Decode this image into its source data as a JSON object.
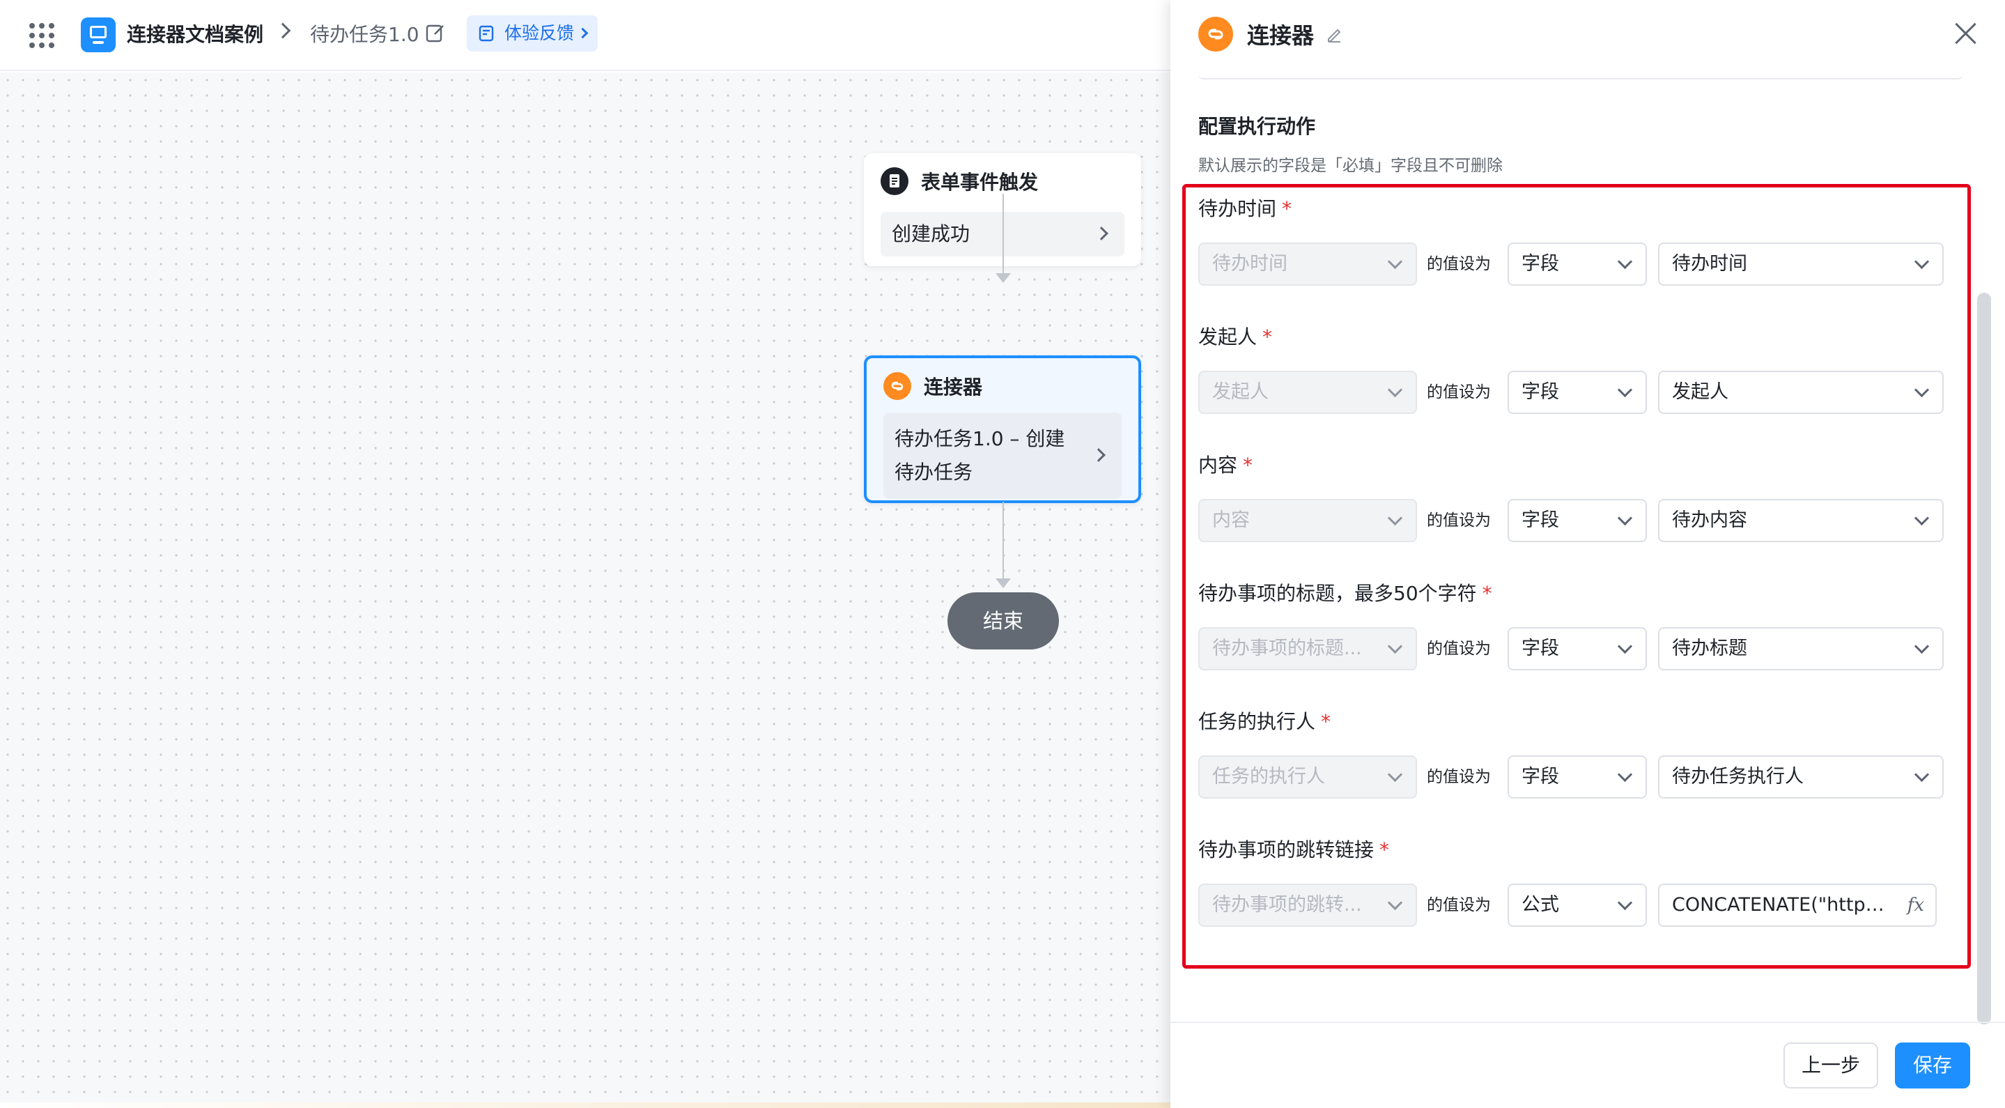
{
  "header": {
    "app_name": "连接器文档案例",
    "page_name": "待办任务1.0",
    "feedback_label": "体验反馈"
  },
  "canvas": {
    "trigger": {
      "title": "表单事件触发",
      "body": "创建成功"
    },
    "connector": {
      "title": "连接器",
      "body": "待办任务1.0 – 创建待办任务"
    },
    "end_label": "结束"
  },
  "panel": {
    "title": "连接器",
    "section_title": "配置执行动作",
    "section_desc": "默认展示的字段是「必填」字段且不可删除",
    "set_as_label": "的值设为",
    "fields": [
      {
        "label": "待办时间",
        "target": "待办时间",
        "mode": "字段",
        "value": "待办时间"
      },
      {
        "label": "发起人",
        "target": "发起人",
        "mode": "字段",
        "value": "发起人"
      },
      {
        "label": "内容",
        "target": "内容",
        "mode": "字段",
        "value": "待办内容"
      },
      {
        "label": "待办事项的标题，最多50个字符",
        "target": "待办事项的标题...",
        "mode": "字段",
        "value": "待办标题"
      },
      {
        "label": "任务的执行人",
        "target": "任务的执行人",
        "mode": "字段",
        "value": "待办任务执行人"
      },
      {
        "label": "待办事项的跳转链接",
        "target": "待办事项的跳转...",
        "mode": "公式",
        "value": "CONCATENATE(\"https:/,",
        "value_icon": "fx"
      }
    ],
    "required_mark": "*",
    "prev_label": "上一步",
    "save_label": "保存"
  },
  "colors": {
    "accent": "#1d8fff",
    "connector_icon": "#ff8a1f",
    "highlight_border": "#e3001b",
    "required": "#e8312f"
  }
}
